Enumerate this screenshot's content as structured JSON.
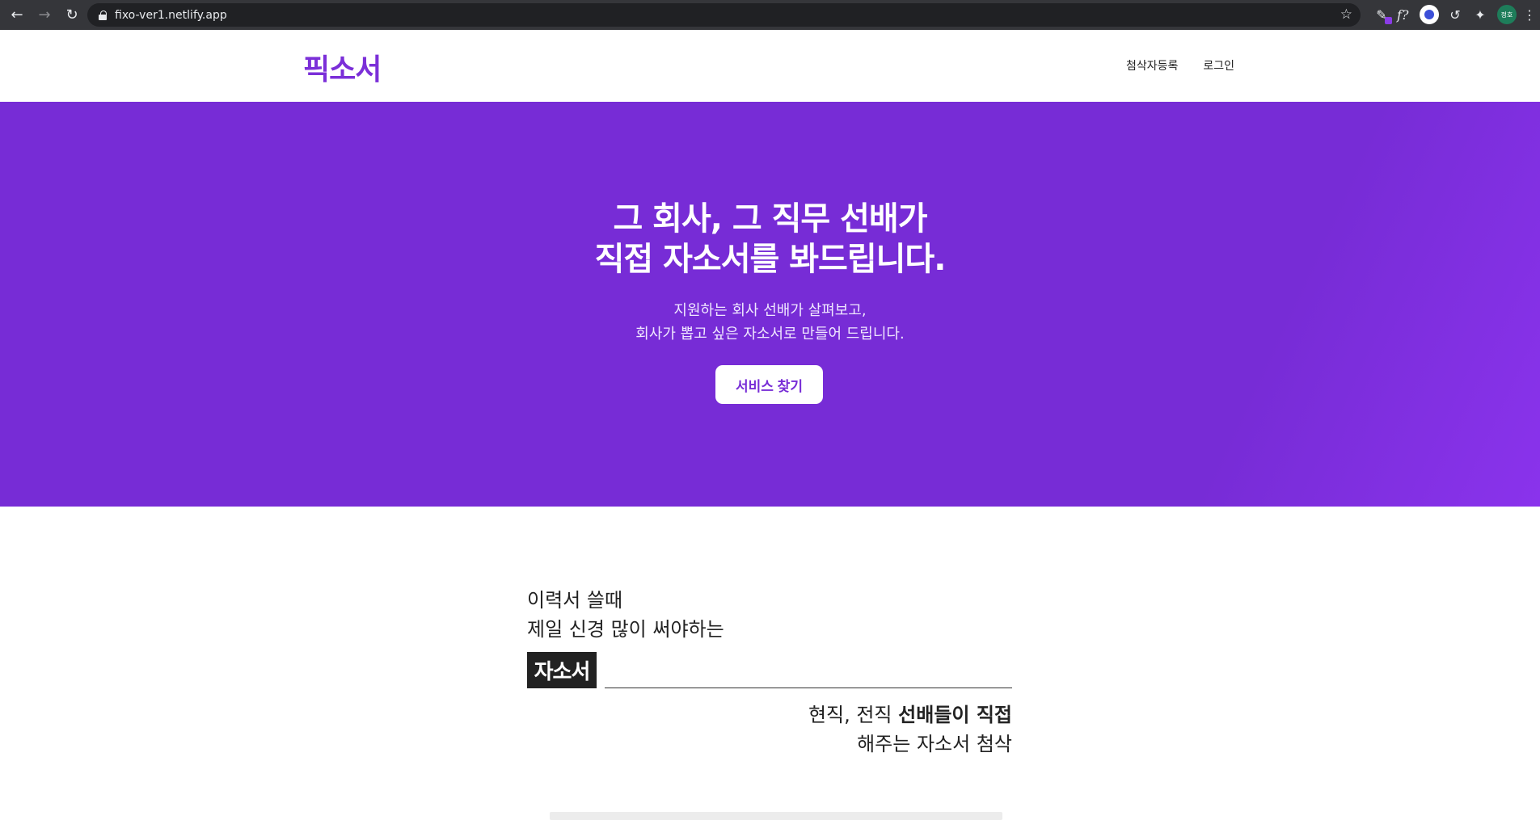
{
  "browser": {
    "url": "fixo-ver1.netlify.app",
    "profile_label": "정호"
  },
  "header": {
    "logo": "픽소서",
    "nav": [
      {
        "label": "첨삭자등록"
      },
      {
        "label": "로그인"
      }
    ]
  },
  "hero": {
    "title_line1": "그 회사, 그 직무 선배가",
    "title_line2": "직접 자소서를 봐드립니다.",
    "subtitle_line1": "지원하는 회사 선배가 살펴보고,",
    "subtitle_line2": "회사가 뽑고 싶은 자소서로 만들어 드립니다.",
    "button_label": "서비스 찾기"
  },
  "feature": {
    "line1": "이력서 쓸때",
    "line2": "제일 신경 많이 써야하는",
    "highlight": "자소서",
    "right_line1_prefix": "현직, 전직 ",
    "right_line1_bold": "선배들이 직접",
    "right_line2": "해주는 자소서 첨삭"
  },
  "colors": {
    "brand": "#772cd6",
    "dark": "#222222"
  }
}
